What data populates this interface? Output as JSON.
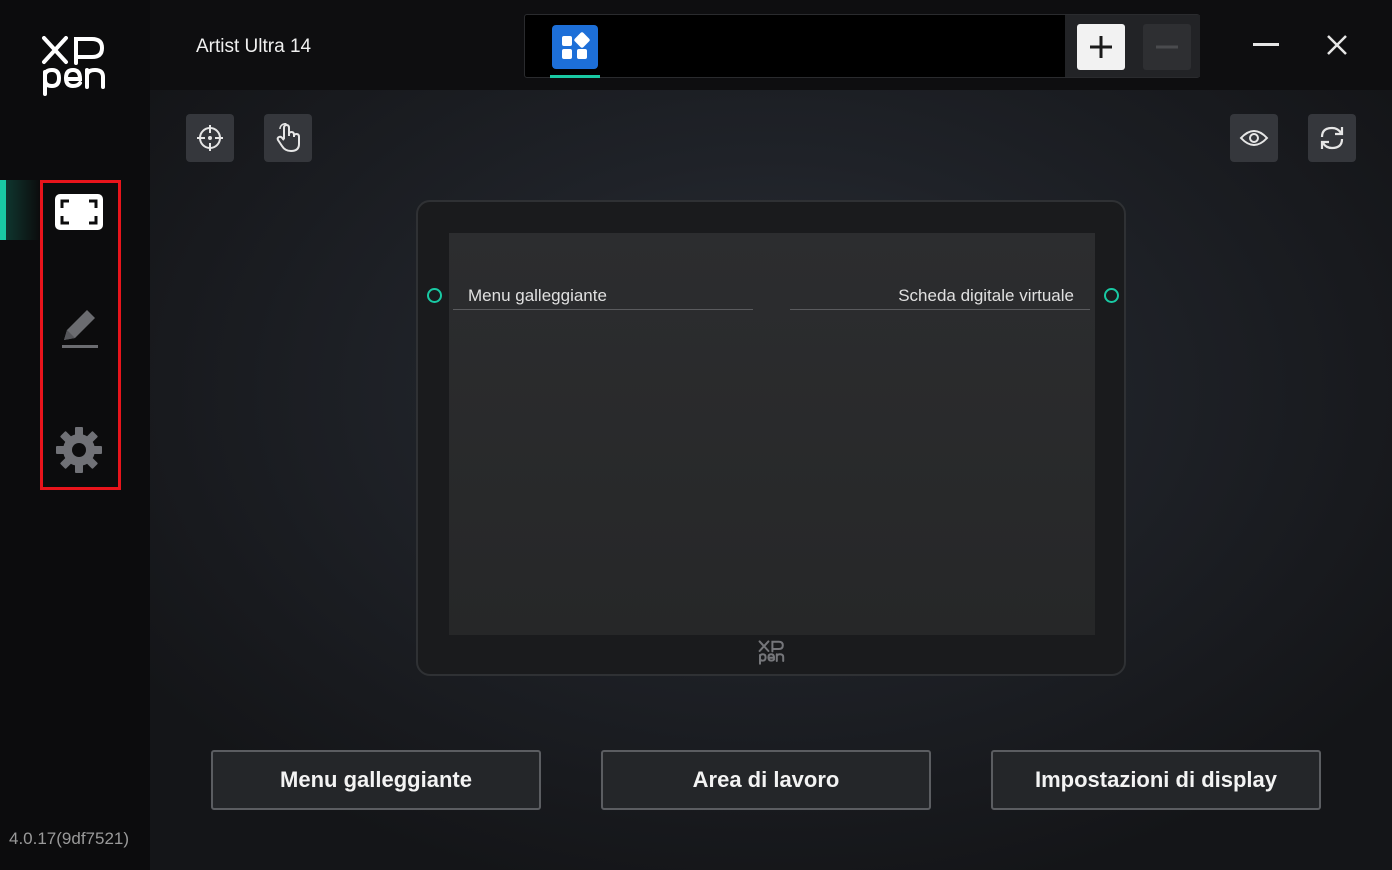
{
  "app": {
    "logo_text": "XP pen",
    "version": "4.0.17(9df7521)"
  },
  "sidebar": {
    "items": [
      {
        "name": "display-mapping",
        "icon": "fullscreen-icon",
        "active": true
      },
      {
        "name": "pen",
        "icon": "pen-icon",
        "active": false
      },
      {
        "name": "settings",
        "icon": "gear-icon",
        "active": false
      }
    ],
    "highlight_color": "#e8141b",
    "accent_color": "#19c9a3"
  },
  "header": {
    "device_name": "Artist Ultra 14",
    "app_tabs": [
      {
        "icon": "apps-grid-icon",
        "active": true
      }
    ],
    "add_icon": "plus-icon",
    "remove_icon": "minus-icon",
    "window_controls": [
      "minimize-icon",
      "close-icon"
    ]
  },
  "toolbar": {
    "left": [
      "crosshair-target-icon",
      "touch-hand-icon"
    ],
    "right": [
      "eye-icon",
      "refresh-icon"
    ]
  },
  "tablet": {
    "logo_text": "XP pen",
    "express_keys": {
      "left": "Menu galleggiante",
      "right": "Scheda digitale virtuale"
    }
  },
  "bottom_buttons": [
    {
      "label": "Menu galleggiante"
    },
    {
      "label": "Area di lavoro"
    },
    {
      "label": "Impostazioni di display"
    }
  ]
}
